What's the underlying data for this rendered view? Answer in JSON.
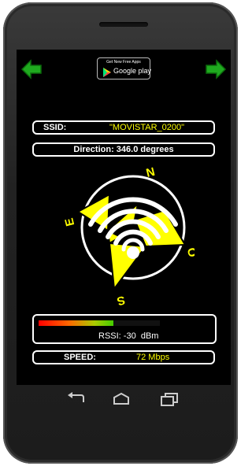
{
  "playstore_badge": {
    "top_text": "Get New Free Apps",
    "main_text": "Google play"
  },
  "ssid": {
    "label": "SSID:",
    "value": "\"MOVISTAR_0200\""
  },
  "direction": {
    "text": "Direction: 346.0 degrees"
  },
  "compass": {
    "heading_degrees": 346.0,
    "letters": {
      "north": "N",
      "east": "E",
      "south": "S",
      "west": "O"
    },
    "needle_color": "#ffff00"
  },
  "rssi": {
    "label": "RSSI:",
    "value": "-30",
    "unit": "dBm",
    "bar_fill_fraction": 0.62
  },
  "speed": {
    "label": "SPEED:",
    "value": "72 Mbps"
  },
  "colors": {
    "accent_text": "#ffff00",
    "arrow": "#1faa1f",
    "screen_bg": "#000000"
  },
  "nav": {
    "back_icon": "back-icon",
    "home_icon": "home-icon",
    "recents_icon": "recents-icon"
  }
}
